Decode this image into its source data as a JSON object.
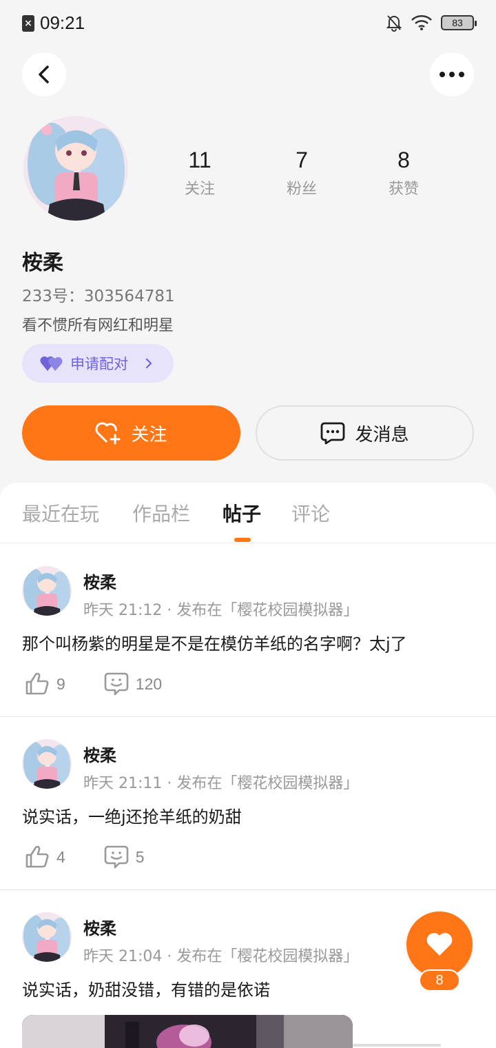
{
  "status_bar": {
    "time": "09:21",
    "battery": "83"
  },
  "profile": {
    "name": "桉柔",
    "uid": "233号：303564781",
    "bio": "看不惯所有网红和明星",
    "stats": [
      {
        "num": "11",
        "label": "关注"
      },
      {
        "num": "7",
        "label": "粉丝"
      },
      {
        "num": "8",
        "label": "获赞"
      }
    ],
    "pair_label": "申请配对",
    "follow_label": "关注",
    "message_label": "发消息"
  },
  "tabs": [
    {
      "label": "最近在玩",
      "active": false
    },
    {
      "label": "作品栏",
      "active": false
    },
    {
      "label": "帖子",
      "active": true
    },
    {
      "label": "评论",
      "active": false
    }
  ],
  "posts": [
    {
      "author": "桉柔",
      "meta": "昨天 21:12 · 发布在「樱花校园模拟器」",
      "text": "那个叫杨紫的明星是不是在模仿羊纸的名字啊？太j了",
      "likes": "9",
      "comments": "120"
    },
    {
      "author": "桉柔",
      "meta": "昨天 21:11 · 发布在「樱花校园模拟器」",
      "text": "说实话，一绝j还抢羊纸的奶甜",
      "likes": "4",
      "comments": "5"
    },
    {
      "author": "桉柔",
      "meta": "昨天 21:04 · 发布在「樱花校园模拟器」",
      "text": "说实话，奶甜没错，有错的是依诺"
    }
  ],
  "fab": {
    "count": "8"
  },
  "colors": {
    "accent": "#ff7617",
    "pair_bg": "#e6e3fa",
    "pair_fg": "#6e63d8"
  }
}
